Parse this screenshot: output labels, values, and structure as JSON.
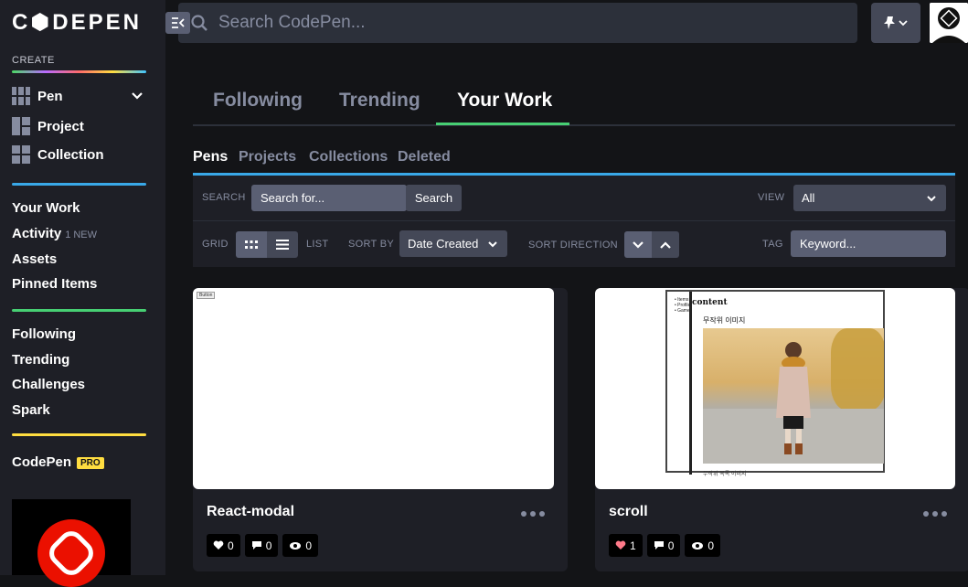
{
  "sidebar": {
    "logo": "C⬢DEPEN",
    "create_label": "CREATE",
    "create_items": [
      {
        "label": "Pen",
        "icon": "pen-grid-icon"
      },
      {
        "label": "Project",
        "icon": "project-grid-icon"
      },
      {
        "label": "Collection",
        "icon": "collection-grid-icon"
      }
    ],
    "nav_group1": [
      {
        "label": "Your Work"
      },
      {
        "label": "Activity",
        "badge": "1 NEW"
      },
      {
        "label": "Assets"
      },
      {
        "label": "Pinned Items"
      }
    ],
    "nav_group2": [
      {
        "label": "Following"
      },
      {
        "label": "Trending"
      },
      {
        "label": "Challenges"
      },
      {
        "label": "Spark"
      }
    ],
    "codepen_label": "CodePen",
    "pro_badge": "PRO"
  },
  "topbar": {
    "search_placeholder": "Search CodePen..."
  },
  "main_tabs": [
    {
      "label": "Following"
    },
    {
      "label": "Trending"
    },
    {
      "label": "Your Work",
      "active": true
    }
  ],
  "sub_tabs": [
    {
      "label": "Pens",
      "active": true
    },
    {
      "label": "Projects"
    },
    {
      "label": "Collections"
    },
    {
      "label": "Deleted"
    }
  ],
  "filters": {
    "search_label": "SEARCH",
    "search_placeholder": "Search for...",
    "search_button": "Search",
    "view_label": "VIEW",
    "view_value": "All",
    "grid_label": "GRID",
    "list_label": "LIST",
    "sortby_label": "SORT BY",
    "sortby_value": "Date Created",
    "sortdir_label": "SORT DIRECTION",
    "tag_label": "TAG",
    "tag_placeholder": "Keyword..."
  },
  "cards": [
    {
      "title": "React-modal",
      "preview_button": "Button",
      "likes": "0",
      "comments": "0",
      "views": "0"
    },
    {
      "title": "scroll",
      "preview_list": [
        "Items",
        "Profile",
        "Game"
      ],
      "preview_heading": "content",
      "preview_sub": "무작위 이미지",
      "preview_bottom": "무작위 목록 이미지",
      "likes": "1",
      "comments": "0",
      "views": "0"
    }
  ],
  "colors": {
    "accent_green": "#47cf73",
    "accent_blue": "#39a8e8",
    "accent_yellow": "#ffdd40",
    "sidebar_bg": "#1e1f26",
    "page_bg": "#131417"
  }
}
